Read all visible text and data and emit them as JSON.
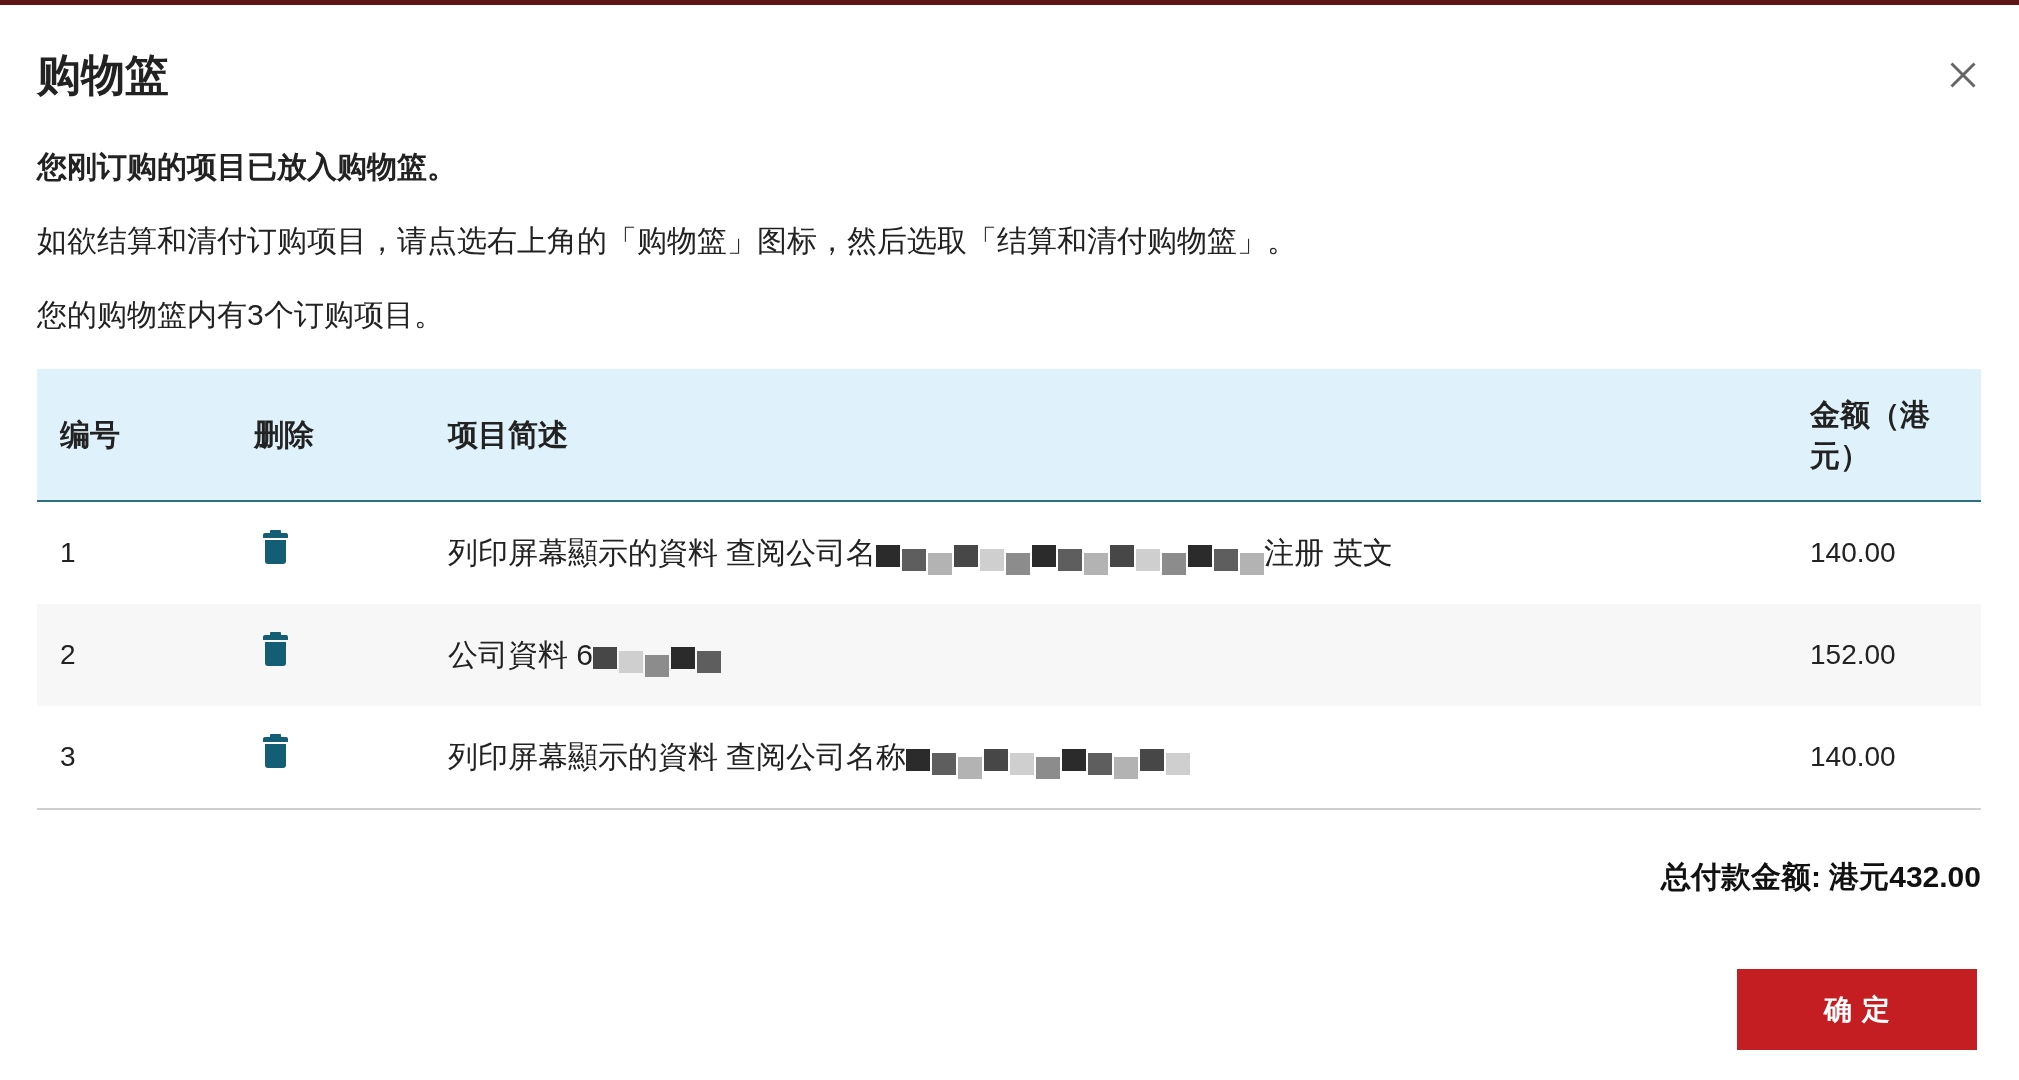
{
  "dialog": {
    "title": "购物篮"
  },
  "messages": [
    {
      "kind": "bold",
      "text": "您刚订购的项目已放入购物篮。"
    },
    {
      "kind": "plain",
      "text": "如欲结算和清付订购项目，请点选右上角的「购物篮」图标，然后选取「结算和清付购物篮」。"
    },
    {
      "kind": "plain",
      "text": "您的购物篮内有3个订购项目。"
    }
  ],
  "table": {
    "columns": [
      "编号",
      "删除",
      "项目简述",
      "金额（港元）"
    ],
    "rows": [
      {
        "number": "1",
        "description": "列印屏幕顯示的資料 查阅公司名",
        "redacted": true,
        "description_tail": "注册 英文",
        "amount": "140.00"
      },
      {
        "number": "2",
        "description": "公司資料 6",
        "redacted": true,
        "amount": "152.00"
      },
      {
        "number": "3",
        "description": "列印屏幕顯示的資料 查阅公司名称",
        "redacted": true,
        "amount": "140.00"
      }
    ]
  },
  "total": "总付款金额: 港元432.00",
  "buttons": [
    {
      "label": "确定"
    }
  ]
}
